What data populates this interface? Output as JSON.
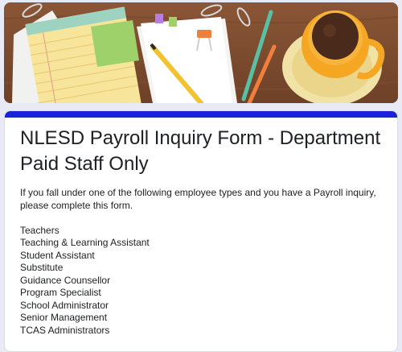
{
  "form": {
    "title": "NLESD Payroll Inquiry Form - Department Paid Staff Only",
    "intro": "If you fall under one of the following employee types and you have a Payroll inquiry, please complete this form.",
    "employee_types": [
      "Teachers",
      "Teaching & Learning Assistant",
      "Student Assistant",
      "Substitute",
      "Guidance Counsellor",
      "Program Specialist",
      "School Administrator",
      "Senior Management",
      "TCAS Administrators"
    ]
  },
  "theme": {
    "accent_color": "#1a23d6",
    "background_color": "#e8eaf6"
  }
}
